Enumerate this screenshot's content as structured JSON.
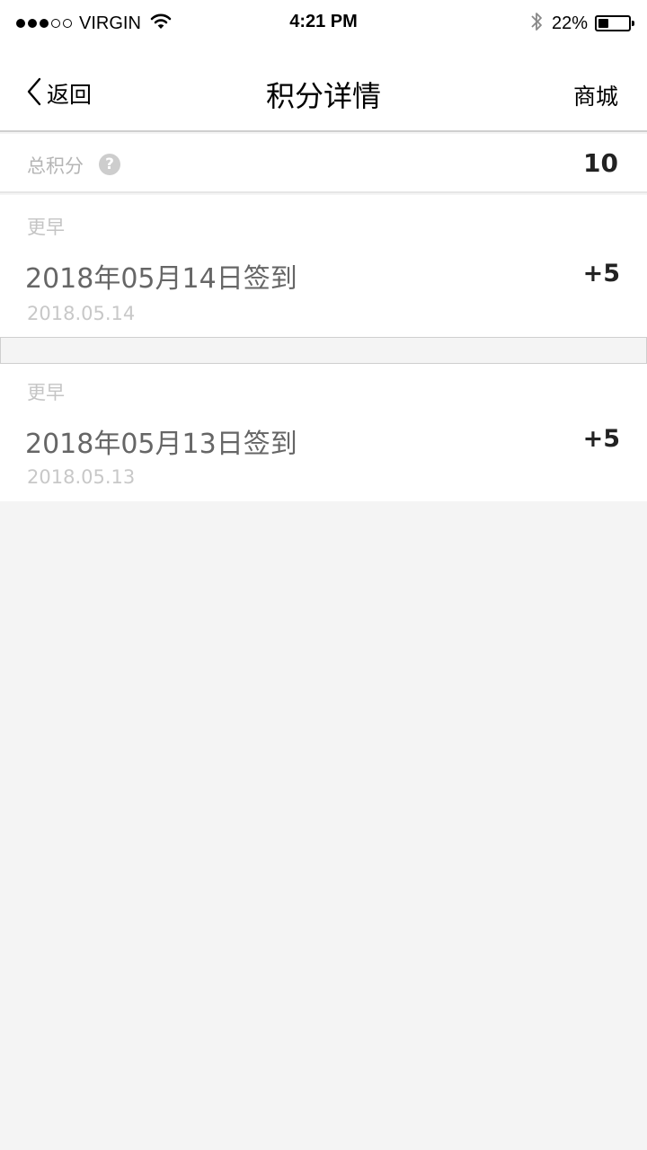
{
  "status_bar": {
    "carrier": "VIRGIN",
    "time": "4:21 PM",
    "battery_percent": "22%",
    "battery_level": 0.22,
    "signal_bars_filled": 3,
    "signal_bars_total": 5,
    "icons": [
      "wifi-icon",
      "bluetooth-icon",
      "battery-icon"
    ]
  },
  "nav": {
    "back_label": "返回",
    "title": "积分详情",
    "right_label": "商城"
  },
  "summary": {
    "label": "总积分",
    "help_glyph": "?",
    "value": "10"
  },
  "records": [
    {
      "group": "更早",
      "title": "2018年05月14日签到",
      "date": "2018.05.14",
      "points": "+5"
    },
    {
      "group": "更早",
      "title": "2018年05月13日签到",
      "date": "2018.05.13",
      "points": "+5"
    }
  ],
  "colors": {
    "background": "#f4f4f4",
    "card": "#ffffff",
    "muted_text": "#c4c4c4",
    "title_text": "#666666",
    "value_text": "#222222"
  }
}
